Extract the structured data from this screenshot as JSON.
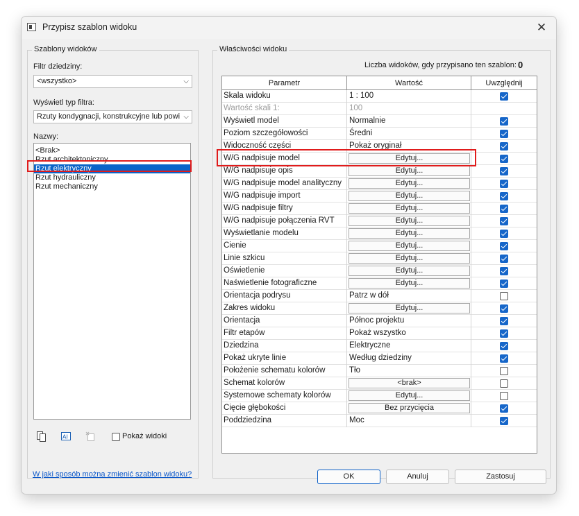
{
  "dialog": {
    "title": "Przypisz szablon widoku",
    "close_glyph": "✕"
  },
  "left": {
    "group_label": "Szablony widoków",
    "discipline_filter_label": "Filtr dziedziny:",
    "discipline_filter_value": "<wszystko>",
    "view_type_label": "Wyświetl typ filtra:",
    "view_type_value": "Rzuty kondygnacji, konstrukcyjne lub powi",
    "names_label": "Nazwy:",
    "names": [
      "<Brak>",
      "Rzut architektoniczny",
      "Rzut elektryczny",
      "Rzut hydrauliczny",
      "Rzut mechaniczny"
    ],
    "selected_index": 2,
    "show_views_label": "Pokaż widoki"
  },
  "right": {
    "group_label": "Właściwości widoku",
    "count_label": "Liczba widoków, gdy przypisano ten szablon:",
    "count_value": "0",
    "headers": {
      "param": "Parametr",
      "value": "Wartość",
      "include": "Uwzględnij"
    },
    "rows": [
      {
        "param": "Skala widoku",
        "value": "1 : 100",
        "kind": "text",
        "include": true
      },
      {
        "param": "Wartość skali   1:",
        "value": "100",
        "kind": "text",
        "include": null,
        "disabled": true
      },
      {
        "param": "Wyświetl model",
        "value": "Normalnie",
        "kind": "text",
        "include": true
      },
      {
        "param": "Poziom szczegółowości",
        "value": "Średni",
        "kind": "text",
        "include": true
      },
      {
        "param": "Widoczność części",
        "value": "Pokaż oryginał",
        "kind": "text",
        "include": true
      },
      {
        "param": "W/G nadpisuje model",
        "value": "Edytuj...",
        "kind": "button",
        "include": true
      },
      {
        "param": "W/G nadpisuje opis",
        "value": "Edytuj...",
        "kind": "button",
        "include": true
      },
      {
        "param": "W/G nadpisuje model analityczny",
        "value": "Edytuj...",
        "kind": "button",
        "include": true
      },
      {
        "param": "W/G nadpisuje import",
        "value": "Edytuj...",
        "kind": "button",
        "include": true
      },
      {
        "param": "W/G nadpisuje filtry",
        "value": "Edytuj...",
        "kind": "button",
        "include": true
      },
      {
        "param": "W/G nadpisuje połączenia RVT",
        "value": "Edytuj...",
        "kind": "button",
        "include": true
      },
      {
        "param": "Wyświetlanie modelu",
        "value": "Edytuj...",
        "kind": "button",
        "include": true
      },
      {
        "param": "Cienie",
        "value": "Edytuj...",
        "kind": "button",
        "include": true
      },
      {
        "param": "Linie szkicu",
        "value": "Edytuj...",
        "kind": "button",
        "include": true
      },
      {
        "param": "Oświetlenie",
        "value": "Edytuj...",
        "kind": "button",
        "include": true
      },
      {
        "param": "Naświetlenie fotograficzne",
        "value": "Edytuj...",
        "kind": "button",
        "include": true
      },
      {
        "param": "Orientacja podrysu",
        "value": "Patrz w dół",
        "kind": "text",
        "include": false
      },
      {
        "param": "Zakres widoku",
        "value": "Edytuj...",
        "kind": "button",
        "include": true
      },
      {
        "param": "Orientacja",
        "value": "Północ projektu",
        "kind": "text",
        "include": true
      },
      {
        "param": "Filtr etapów",
        "value": "Pokaż wszystko",
        "kind": "text",
        "include": true
      },
      {
        "param": "Dziedzina",
        "value": "Elektryczne",
        "kind": "text",
        "include": true
      },
      {
        "param": "Pokaż ukryte linie",
        "value": "Według dziedziny",
        "kind": "text",
        "include": true
      },
      {
        "param": "Położenie schematu kolorów",
        "value": "Tło",
        "kind": "text",
        "include": false
      },
      {
        "param": "Schemat kolorów",
        "value": "<brak>",
        "kind": "button",
        "include": false
      },
      {
        "param": "Systemowe schematy kolorów",
        "value": "Edytuj...",
        "kind": "button",
        "include": false
      },
      {
        "param": "Cięcie głębokości",
        "value": "Bez przycięcia",
        "kind": "button",
        "include": true
      },
      {
        "param": "Poddziedzina",
        "value": "Moc",
        "kind": "text",
        "include": true
      }
    ],
    "highlighted_row": 5
  },
  "footer": {
    "help_link": "W jaki sposób można zmienić szablon widoku?",
    "ok": "OK",
    "cancel": "Anuluj",
    "apply": "Zastosuj"
  },
  "colors": {
    "selection": "#0a64c8",
    "highlight": "#e01b1b",
    "checkbox": "#1666c9",
    "link": "#0b57c9"
  }
}
